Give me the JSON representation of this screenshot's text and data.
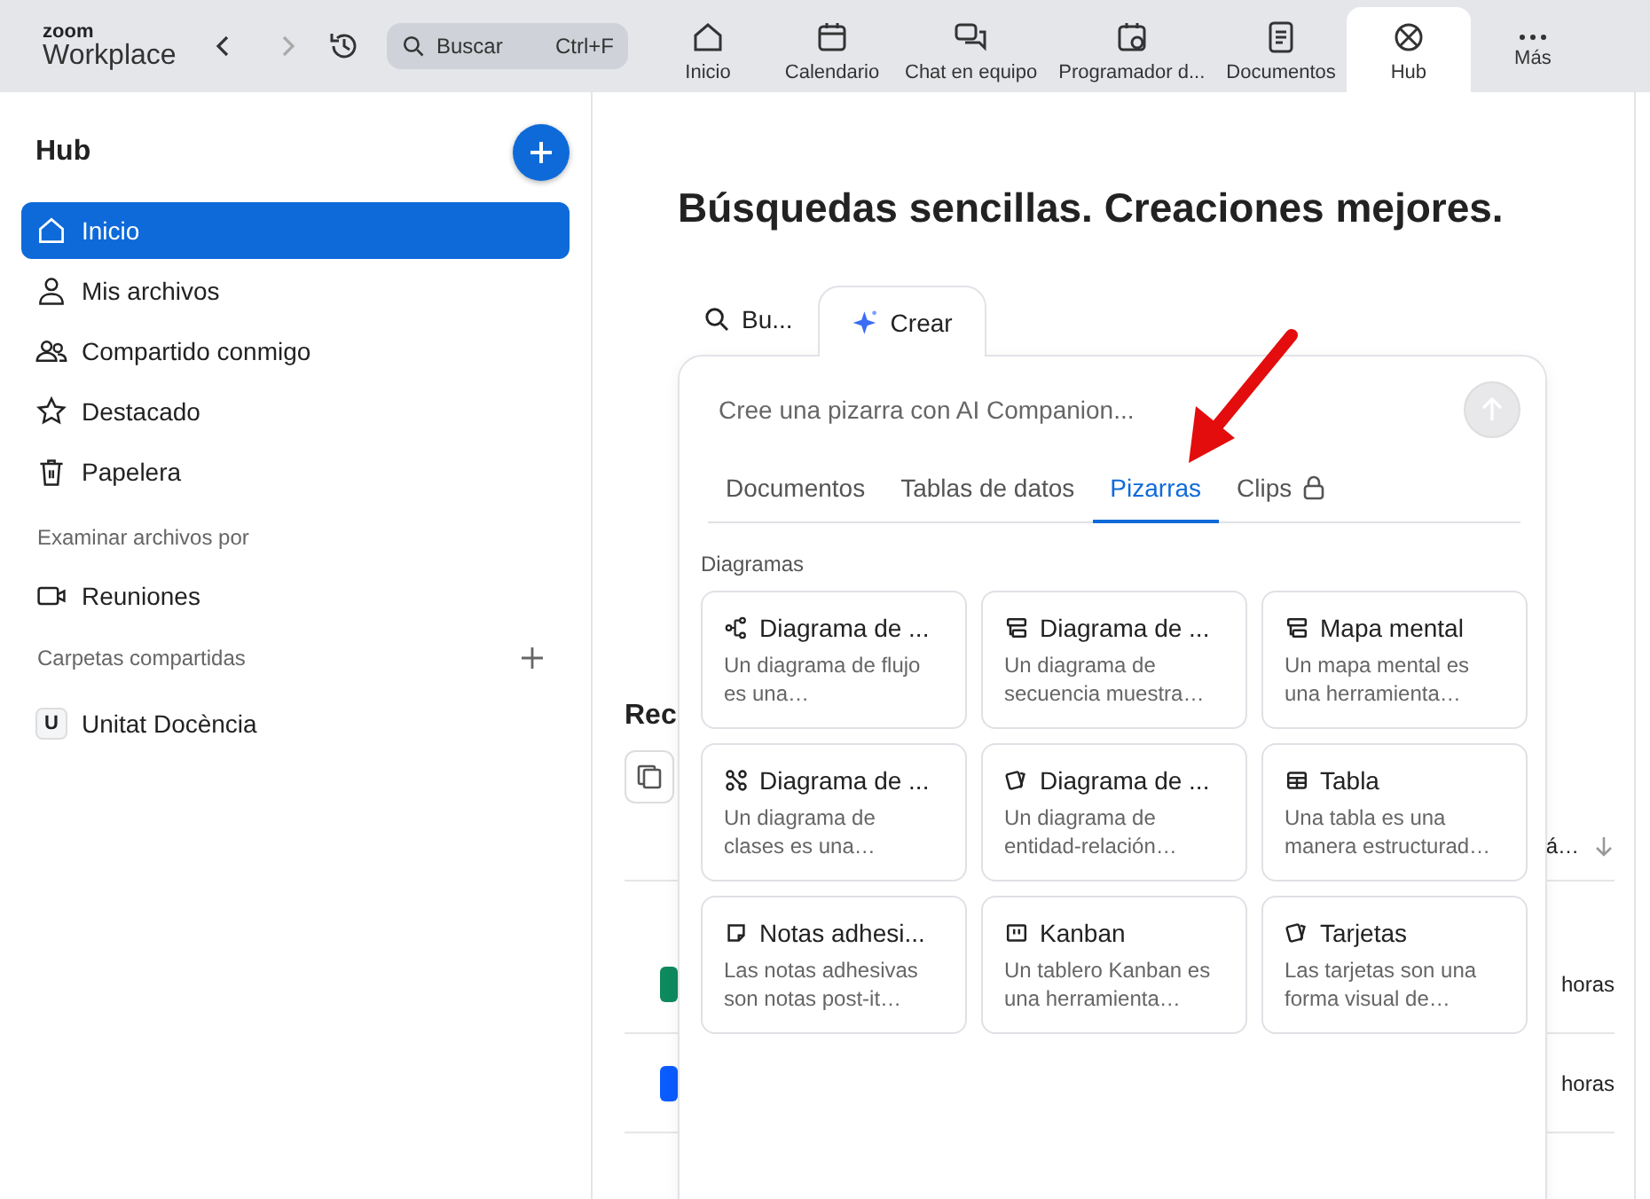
{
  "topbar": {
    "logo": {
      "line1": "zoom",
      "line2": "Workplace"
    },
    "search": {
      "placeholder": "Buscar",
      "shortcut": "Ctrl+F"
    },
    "nav": [
      {
        "label": "Inicio",
        "kind": "home",
        "selected": false
      },
      {
        "label": "Calendario",
        "kind": "calendar",
        "selected": false
      },
      {
        "label": "Chat en equipo",
        "kind": "chat",
        "selected": false
      },
      {
        "label": "Programador d...",
        "kind": "scheduler",
        "selected": false
      },
      {
        "label": "Documentos",
        "kind": "doc",
        "selected": false
      },
      {
        "label": "Hub",
        "kind": "hub",
        "selected": true
      },
      {
        "label": "Más",
        "kind": "more",
        "selected": false
      }
    ]
  },
  "sidebar": {
    "title": "Hub",
    "items": [
      {
        "label": "Inicio",
        "kind": "home",
        "selected": true
      },
      {
        "label": "Mis archivos",
        "kind": "person",
        "selected": false
      },
      {
        "label": "Compartido conmigo",
        "kind": "people",
        "selected": false
      },
      {
        "label": "Destacado",
        "kind": "star",
        "selected": false
      },
      {
        "label": "Papelera",
        "kind": "trash",
        "selected": false
      }
    ],
    "browse_label": "Examinar archivos por",
    "browse_items": [
      {
        "label": "Reuniones",
        "kind": "video",
        "selected": false
      }
    ],
    "folders_label": "Carpetas compartidas",
    "folders": [
      {
        "badge": "U",
        "label": "Unitat Docència"
      }
    ]
  },
  "main": {
    "headline": "Búsquedas sencillas. Creaciones mejores.",
    "background": {
      "heading": "Rec",
      "header_col_2": "á…",
      "times": [
        {
          "text": "horas",
          "color": "#0e8a5f"
        },
        {
          "text": "horas",
          "color": "#0b5cff"
        }
      ]
    },
    "modes": [
      {
        "label": "Bu...",
        "kind": "search",
        "selected": false
      },
      {
        "label": "Crear",
        "kind": "sparkle",
        "selected": true
      }
    ],
    "prompt": {
      "placeholder": "Cree una pizarra con AI Companion..."
    },
    "categories": [
      {
        "label": "Documentos",
        "selected": false,
        "locked": false
      },
      {
        "label": "Tablas de datos",
        "selected": false,
        "locked": false
      },
      {
        "label": "Pizarras",
        "selected": true,
        "locked": false
      },
      {
        "label": "Clips",
        "selected": false,
        "locked": true
      }
    ],
    "section": "Diagramas",
    "cards": [
      {
        "kind": "flow",
        "title": "Diagrama de ...",
        "description": [
          "Un diagrama de flujo",
          "es una…"
        ]
      },
      {
        "kind": "sequence",
        "title": "Diagrama de ...",
        "description": [
          "Un diagrama de",
          "secuencia muestra…"
        ]
      },
      {
        "kind": "sequence",
        "title": "Mapa mental",
        "description": [
          "Un mapa mental es",
          "una herramienta…"
        ]
      },
      {
        "kind": "class",
        "title": "Diagrama de ...",
        "description": [
          "Un diagrama de",
          "clases es una…"
        ]
      },
      {
        "kind": "cards",
        "title": "Diagrama de ...",
        "description": [
          "Un diagrama de",
          "entidad-relación…"
        ]
      },
      {
        "kind": "table",
        "title": "Tabla",
        "description": [
          "Una tabla es una",
          "manera estructurad…"
        ]
      },
      {
        "kind": "note",
        "title": "Notas adhesi...",
        "description": [
          "Las notas adhesivas",
          "son notas post-it…"
        ]
      },
      {
        "kind": "kanban",
        "title": "Kanban",
        "description": [
          "Un tablero Kanban es",
          "una herramienta…"
        ]
      },
      {
        "kind": "cards",
        "title": "Tarjetas",
        "description": [
          "Las tarjetas son una",
          "forma visual de…"
        ]
      }
    ]
  }
}
